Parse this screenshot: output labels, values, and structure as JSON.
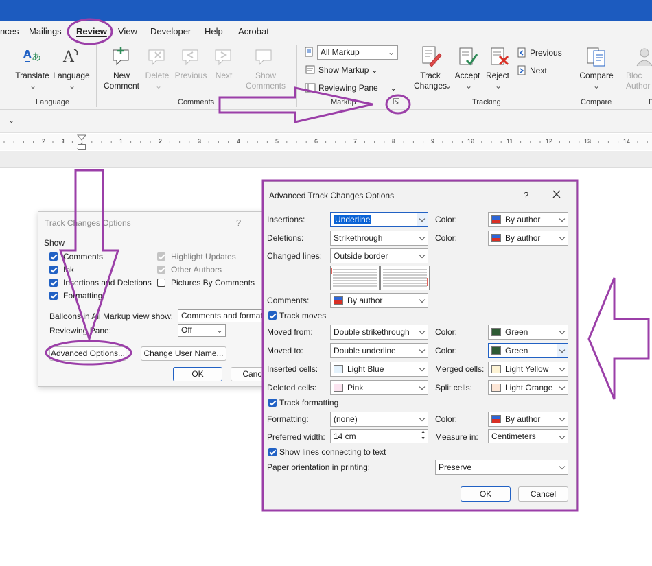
{
  "ribbon_tabs": [
    "nces",
    "Mailings",
    "Review",
    "View",
    "Developer",
    "Help",
    "Acrobat"
  ],
  "ribbon": {
    "language_group": "Language",
    "translate": "Translate",
    "language": "Language",
    "comments_group": "Comments",
    "new_comment": "New\nComment",
    "delete": "Delete",
    "previous": "Previous",
    "next": "Next",
    "show_comments": "Show\nComments",
    "markup_group": "Markup",
    "all_markup": "All Markup",
    "show_markup": "Show Markup",
    "reviewing_pane": "Reviewing Pane",
    "tracking_group": "Tracking",
    "track_changes": "Track\nChanges",
    "accept": "Accept",
    "reject": "Reject",
    "previous_change": "Previous",
    "next_change": "Next",
    "compare_group": "Compare",
    "compare": "Compare",
    "block_authors": "Bloc\nAuthor",
    "protect_group": "P"
  },
  "ruler_numbers": [
    "2",
    "1",
    "1",
    "2",
    "3",
    "4",
    "5",
    "6",
    "7",
    "8",
    "9",
    "10",
    "11",
    "12",
    "13",
    "14"
  ],
  "track_changes_dialog": {
    "title": "Track Changes Options",
    "help": "?",
    "show_label": "Show",
    "comments": "Comments",
    "ink": "Ink",
    "insertions_deletions": "Insertions and Deletions",
    "formatting": "Formatting",
    "highlight_updates": "Highlight Updates",
    "other_authors": "Other Authors",
    "pictures_by_comments": "Pictures By Comments",
    "balloons_label": "Balloons in All Markup view show:",
    "balloons_value": "Comments and formatting",
    "reviewing_pane_label": "Reviewing Pane:",
    "reviewing_pane_value": "Off",
    "advanced_options": "Advanced Options...",
    "change_user_name": "Change User Name...",
    "ok": "OK",
    "cancel": "Cancel"
  },
  "advanced_dialog": {
    "title": "Advanced Track Changes Options",
    "help": "?",
    "close": "X",
    "insertions_label": "Insertions:",
    "insertions_value": "Underline",
    "deletions_label": "Deletions:",
    "deletions_value": "Strikethrough",
    "changed_lines_label": "Changed lines:",
    "changed_lines_value": "Outside border",
    "comments_label": "Comments:",
    "comments_value": "By author",
    "color_label": "Color:",
    "insertions_color": "By author",
    "deletions_color": "By author",
    "track_moves": "Track moves",
    "moved_from_label": "Moved from:",
    "moved_from_value": "Double strikethrough",
    "moved_from_color": "Green",
    "moved_to_label": "Moved to:",
    "moved_to_value": "Double underline",
    "moved_to_color": "Green",
    "inserted_cells_label": "Inserted cells:",
    "inserted_cells_value": "Light Blue",
    "merged_cells_label": "Merged cells:",
    "merged_cells_value": "Light Yellow",
    "deleted_cells_label": "Deleted cells:",
    "deleted_cells_value": "Pink",
    "split_cells_label": "Split cells:",
    "split_cells_value": "Light Orange",
    "track_formatting": "Track formatting",
    "formatting_label": "Formatting:",
    "formatting_value": "(none)",
    "formatting_color": "By author",
    "preferred_width_label": "Preferred width:",
    "preferred_width_value": "14 cm",
    "measure_in_label": "Measure in:",
    "measure_in_value": "Centimeters",
    "show_lines": "Show lines connecting to text",
    "paper_orientation_label": "Paper orientation in printing:",
    "paper_orientation_value": "Preserve",
    "ok": "OK",
    "cancel": "Cancel"
  },
  "colors": {
    "title_bar": "#1c5bbf",
    "annotation": "#9b3fa8",
    "accent": "#2161c4",
    "green": "#2e7d3a",
    "light_blue": "#e4f2fc",
    "light_yellow": "#fdf3d4",
    "pink": "#fce4f0",
    "light_orange": "#fde6d6"
  }
}
